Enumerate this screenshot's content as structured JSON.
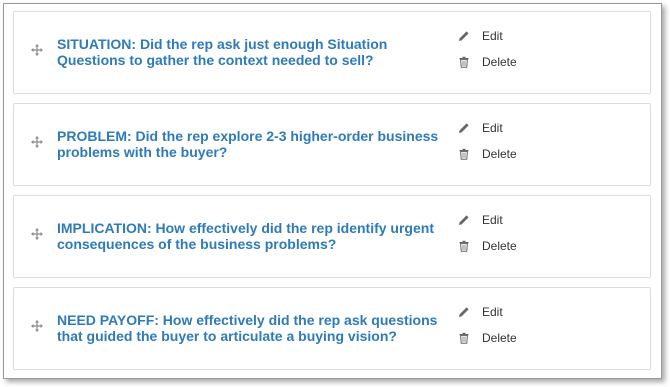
{
  "questions": [
    {
      "text": "SITUATION: Did the rep ask just enough Situation Questions to gather the context needed to sell?",
      "edit_label": "Edit",
      "delete_label": "Delete"
    },
    {
      "text": "PROBLEM: Did the rep explore 2-3 higher-order business problems with the buyer?",
      "edit_label": "Edit",
      "delete_label": "Delete"
    },
    {
      "text": "IMPLICATION: How effectively did the rep identify urgent consequences of the business problems?",
      "edit_label": "Edit",
      "delete_label": "Delete"
    },
    {
      "text": "NEED PAYOFF: How effectively did the rep ask questions that guided the buyer to articulate a buying vision?",
      "edit_label": "Edit",
      "delete_label": "Delete"
    }
  ],
  "icons": {
    "drag": "drag-handle-icon",
    "edit": "pencil-icon",
    "delete": "trash-icon"
  },
  "colors": {
    "question_text": "#2e7bb8",
    "action_text": "#333333",
    "icon": "#666666",
    "card_border": "#dcdcdc"
  }
}
